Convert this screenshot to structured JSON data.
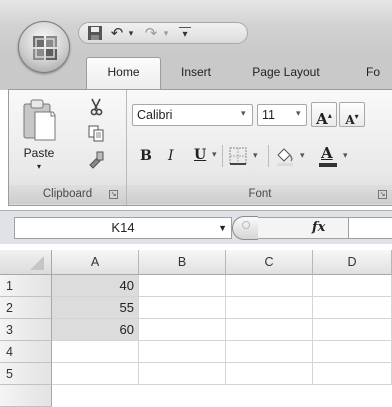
{
  "quick_access": {
    "save_icon": "save-icon",
    "undo_glyph": "↶",
    "redo_glyph": "↷",
    "customize_glyph": "▾"
  },
  "tabs": [
    {
      "label": "Home",
      "active": true
    },
    {
      "label": "Insert",
      "active": false
    },
    {
      "label": "Page Layout",
      "active": false
    },
    {
      "label": "Fo",
      "active": false
    }
  ],
  "clipboard": {
    "paste_label": "Paste",
    "group_label": "Clipboard"
  },
  "font": {
    "name": "Calibri",
    "size": "11",
    "grow": "A",
    "shrink": "A",
    "bold": "B",
    "italic": "I",
    "underline": "U",
    "font_color_letter": "A",
    "group_label": "Font"
  },
  "formula_bar": {
    "name_box": "K14",
    "fx": "fx",
    "content": ""
  },
  "sheet": {
    "columns": [
      "A",
      "B",
      "C",
      "D"
    ],
    "rows": [
      {
        "num": "1",
        "cells": [
          "40",
          "",
          "",
          ""
        ]
      },
      {
        "num": "2",
        "cells": [
          "55",
          "",
          "",
          ""
        ]
      },
      {
        "num": "3",
        "cells": [
          "60",
          "",
          "",
          ""
        ]
      },
      {
        "num": "4",
        "cells": [
          "",
          "",
          "",
          ""
        ]
      },
      {
        "num": "5",
        "cells": [
          "",
          "",
          "",
          ""
        ]
      }
    ]
  },
  "colors": {
    "selection": "#dcdcdc",
    "font_color_bar": "#c00000"
  }
}
